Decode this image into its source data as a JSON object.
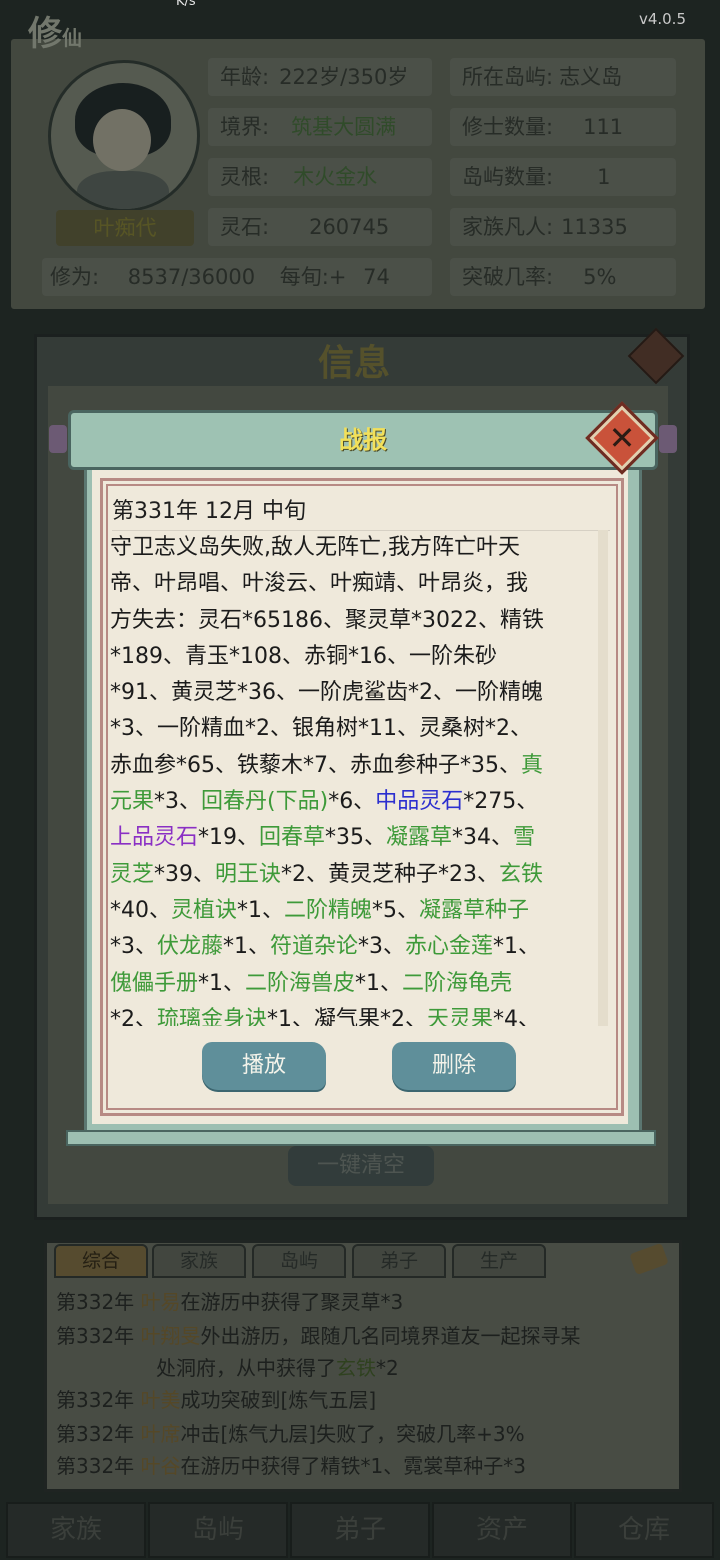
{
  "status_bar": {
    "left": "K/s",
    "version": "v4.0.5"
  },
  "game": {
    "logo_main": "修",
    "logo_sub": "仙",
    "character_name": "叶痴代",
    "stats": [
      {
        "label": "年龄:",
        "value": "222岁/350岁"
      },
      {
        "label": "境界:",
        "value": "筑基大圆满"
      },
      {
        "label": "灵根:",
        "value": "木火金水"
      },
      {
        "label": "灵石:",
        "value": "260745"
      },
      {
        "label": "所在岛屿:",
        "value": "志义岛"
      },
      {
        "label": "修士数量:",
        "value": "111"
      },
      {
        "label": "岛屿数量:",
        "value": "1"
      },
      {
        "label": "家族凡人:",
        "value": "11335"
      }
    ],
    "cultivation_label": "修为:",
    "cultivation_value": "8537/36000",
    "per_turn_label": "每旬:+",
    "per_turn_value": "74",
    "breakthrough_label": "突破几率:",
    "breakthrough_value": "5%",
    "info_title": "信息",
    "clear_all": "一键清空",
    "log_tabs": [
      "综合",
      "家族",
      "岛屿",
      "弟子",
      "生产"
    ],
    "log_entries": [
      {
        "year": "第332年",
        "name": "叶易",
        "text": "在游历中获得了聚灵草*3",
        "item": "",
        "rest": ""
      },
      {
        "year": "第332年",
        "name": "叶翔旻",
        "text": "外出游历，跟随几名同境界道友一起探寻某",
        "cont": "处洞府，从中获得了",
        "item": "玄铁",
        "rest": "*2"
      },
      {
        "year": "第332年",
        "name": "叶美",
        "text": "成功突破到[炼气五层]",
        "item": "",
        "rest": ""
      },
      {
        "year": "第332年",
        "name": "叶席",
        "text": "冲击[炼气九层]失败了，突破几率+3%",
        "item": "",
        "rest": ""
      },
      {
        "year": "第332年",
        "name": "叶谷",
        "text": "在游历中获得了精铁*1、霓裳草种子*3",
        "item": "",
        "rest": ""
      }
    ],
    "bottom_nav": [
      "家族",
      "岛屿",
      "弟子",
      "资产",
      "仓库"
    ]
  },
  "dialog": {
    "title": "战报",
    "date": "第331年 12月 中旬",
    "lines": [
      [
        {
          "t": "守卫志义岛失败,敌人无阵亡,我方阵亡叶天",
          "c": ""
        }
      ],
      [
        {
          "t": "帝、叶昂唱、叶浚云、叶痴靖、叶昂炎，我",
          "c": ""
        }
      ],
      [
        {
          "t": "方失去：灵石*65186、聚灵草*3022、精铁",
          "c": ""
        }
      ],
      [
        {
          "t": "*189、青玉*108、赤铜*16、一阶朱砂",
          "c": ""
        }
      ],
      [
        {
          "t": "*91、黄灵芝*36、一阶虎鲨齿*2、一阶精魄",
          "c": ""
        }
      ],
      [
        {
          "t": "*3、一阶精血*2、银角树*11、灵桑树*2、",
          "c": ""
        }
      ],
      [
        {
          "t": "赤血参*65、铁藜木*7、赤血参种子*35、",
          "c": ""
        },
        {
          "t": "真",
          "c": "g"
        }
      ],
      [
        {
          "t": "元果",
          "c": "g"
        },
        {
          "t": "*3、",
          "c": ""
        },
        {
          "t": "回春丹(下品)",
          "c": "g"
        },
        {
          "t": "*6、",
          "c": ""
        },
        {
          "t": "中品灵石",
          "c": "b"
        },
        {
          "t": "*275、",
          "c": ""
        }
      ],
      [
        {
          "t": "上品灵石",
          "c": "p"
        },
        {
          "t": "*19、",
          "c": ""
        },
        {
          "t": "回春草",
          "c": "g"
        },
        {
          "t": "*35、",
          "c": ""
        },
        {
          "t": "凝露草",
          "c": "g"
        },
        {
          "t": "*34、",
          "c": ""
        },
        {
          "t": "雪",
          "c": "g"
        }
      ],
      [
        {
          "t": "灵芝",
          "c": "g"
        },
        {
          "t": "*39、",
          "c": ""
        },
        {
          "t": "明王诀",
          "c": "g"
        },
        {
          "t": "*2、黄灵芝种子*23、",
          "c": ""
        },
        {
          "t": "玄铁",
          "c": "g"
        }
      ],
      [
        {
          "t": "*40、",
          "c": ""
        },
        {
          "t": "灵植诀",
          "c": "g"
        },
        {
          "t": "*1、",
          "c": ""
        },
        {
          "t": "二阶精魄",
          "c": "g"
        },
        {
          "t": "*5、",
          "c": ""
        },
        {
          "t": "凝露草种子",
          "c": "g"
        }
      ],
      [
        {
          "t": "*3、",
          "c": ""
        },
        {
          "t": "伏龙藤",
          "c": "g"
        },
        {
          "t": "*1、",
          "c": ""
        },
        {
          "t": "符道杂论",
          "c": "g"
        },
        {
          "t": "*3、",
          "c": ""
        },
        {
          "t": "赤心金莲",
          "c": "g"
        },
        {
          "t": "*1、",
          "c": ""
        }
      ],
      [
        {
          "t": "傀儡手册",
          "c": "g"
        },
        {
          "t": "*1、",
          "c": ""
        },
        {
          "t": "二阶海兽皮",
          "c": "g"
        },
        {
          "t": "*1、",
          "c": ""
        },
        {
          "t": "二阶海龟壳",
          "c": "g"
        }
      ],
      [
        {
          "t": "*2、",
          "c": ""
        },
        {
          "t": "琉璃金身诀",
          "c": "g"
        },
        {
          "t": "*1、凝气果*2、",
          "c": ""
        },
        {
          "t": "天灵果",
          "c": "g"
        },
        {
          "t": "*4、",
          "c": ""
        }
      ]
    ],
    "buttons": {
      "play": "播放",
      "delete": "删除"
    },
    "colors": {
      "green": "#3e9a39",
      "blue": "#2c2fcf",
      "purple": "#8a2fc4",
      "title": "#f2e05a"
    }
  }
}
